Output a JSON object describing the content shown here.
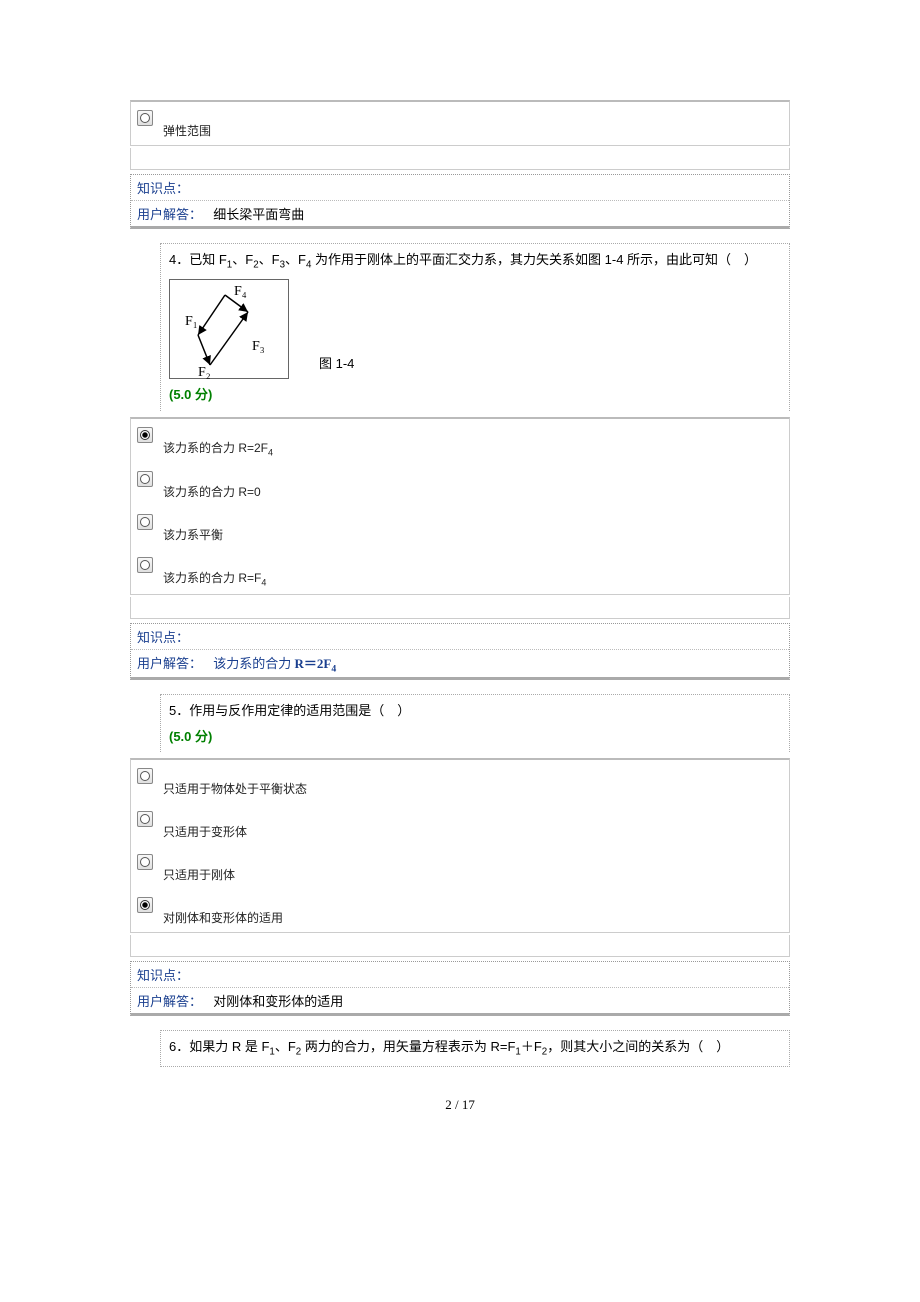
{
  "q3_option": "弹性范围",
  "q3_meta": {
    "k_label": "知识点：",
    "a_label": "用户解答：",
    "a_value": "细长梁平面弯曲"
  },
  "q4": {
    "num": "4．",
    "text_a": "已知 F",
    "s1": "1",
    "text_b": "、F",
    "s2": "2",
    "text_c": "、F",
    "s3": "3",
    "text_d": "、F",
    "s4": "4",
    "text_e": " 为作用于刚体上的平面汇交力系，其力矢关系如图 1-4 所示，由此可知（　）",
    "fig_caption": "图  1-4",
    "points": "(5.0  分)",
    "svg_labels": {
      "f1": "F₁",
      "f2": "F₂",
      "f3": "F₃",
      "f4": "F₄"
    },
    "opts": {
      "a_pre": "该力系的合力 R=2F",
      "a_sub": "4",
      "b": "该力系的合力 R=0",
      "c": "该力系平衡",
      "d_pre": "该力系的合力 R=F",
      "d_sub": "4"
    },
    "meta": {
      "k_label": "知识点：",
      "a_label": "用户解答：",
      "a_pre": "该力系的合力 ",
      "a_bold": "R＝2F",
      "a_sub": "4"
    }
  },
  "q5": {
    "num": "5．",
    "text": "作用与反作用定律的适用范围是（　）",
    "points": "(5.0  分)",
    "opts": {
      "a": "只适用于物体处于平衡状态",
      "b": "只适用于变形体",
      "c": "只适用于刚体",
      "d": "对刚体和变形体的适用"
    },
    "meta": {
      "k_label": "知识点：",
      "a_label": "用户解答：",
      "a_value": "对刚体和变形体的适用"
    }
  },
  "q6": {
    "num": "6．",
    "text_a": "如果力 R 是 F",
    "s1": "1",
    "text_b": "、F",
    "s2": "2",
    "text_c": " 两力的合力，用矢量方程表示为 R=F",
    "s3": "1",
    "text_d": "＋F",
    "s4": "2",
    "text_e": "，则其大小之间的关系为（　）"
  },
  "footer": {
    "page": "2",
    "sep": " / ",
    "total": "17"
  }
}
